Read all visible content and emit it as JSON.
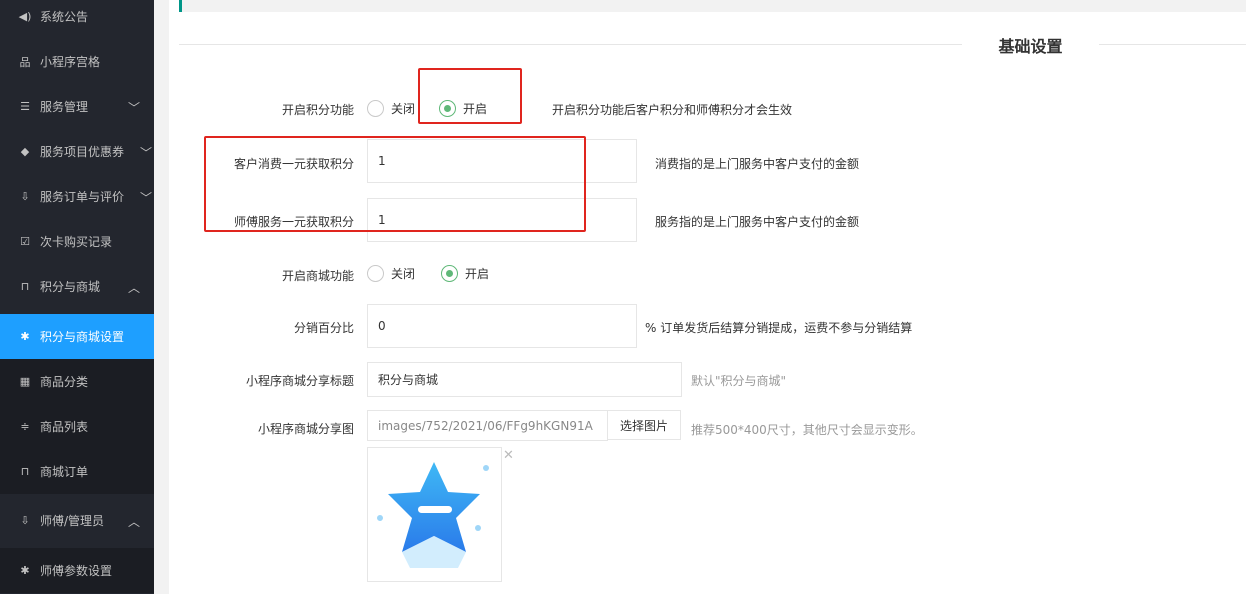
{
  "sidebar": {
    "items": [
      {
        "label": "系统公告",
        "icon": "volume-icon",
        "glyph": "◀)"
      },
      {
        "label": "小程序宫格",
        "icon": "sitemap-icon",
        "glyph": "品"
      },
      {
        "label": "服务管理",
        "icon": "list-icon",
        "glyph": "☰",
        "arrow": "﹀"
      },
      {
        "label": "服务项目优惠券",
        "icon": "tag-icon",
        "glyph": "◆",
        "arrow": "﹀"
      },
      {
        "label": "服务订单与评价",
        "icon": "download-icon",
        "glyph": "⇩",
        "arrow": "﹀"
      },
      {
        "label": "次卡购买记录",
        "icon": "check-square-icon",
        "glyph": "☑"
      },
      {
        "label": "积分与商城",
        "icon": "cart-icon",
        "glyph": "⊓",
        "arrow": "︿"
      },
      {
        "label": "积分与商城设置",
        "icon": "gear-icon",
        "glyph": "✱"
      },
      {
        "label": "商品分类",
        "icon": "grid-icon",
        "glyph": "▦"
      },
      {
        "label": "商品列表",
        "icon": "sliders-icon",
        "glyph": "≑"
      },
      {
        "label": "商城订单",
        "icon": "cart-icon",
        "glyph": "⊓"
      },
      {
        "label": "师傅/管理员",
        "icon": "download-icon",
        "glyph": "⇩",
        "arrow": "︿"
      },
      {
        "label": "师傅参数设置",
        "icon": "gear-icon",
        "glyph": "✱"
      }
    ]
  },
  "section": {
    "title": "基础设置"
  },
  "form": {
    "points_enable": {
      "label": "开启积分功能",
      "off": "关闭",
      "on": "开启",
      "selected": "开启",
      "hint": "开启积分功能后客户积分和师傅积分才会生效"
    },
    "customer_points": {
      "label": "客户消费一元获取积分",
      "value": "1",
      "hint": "消费指的是上门服务中客户支付的金额"
    },
    "master_points": {
      "label": "师傅服务一元获取积分",
      "value": "1",
      "hint": "服务指的是上门服务中客户支付的金额"
    },
    "mall_enable": {
      "label": "开启商城功能",
      "off": "关闭",
      "on": "开启",
      "selected": "开启"
    },
    "distribution": {
      "label": "分销百分比",
      "value": "0",
      "hint": "%  订单发货后结算分销提成，运费不参与分销结算"
    },
    "share_title": {
      "label": "小程序商城分享标题",
      "value": "积分与商城",
      "hint": "默认\"积分与商城\""
    },
    "share_image": {
      "label": "小程序商城分享图",
      "value": "images/752/2021/06/FFg9hKGN91A",
      "button": "选择图片",
      "hint": "推荐500*400尺寸，其他尺寸会显示变形。"
    }
  },
  "colors": {
    "accent": "#1e9fff",
    "radio_on": "#5fb878",
    "highlight": "#e0251e",
    "sidebar": "#23262e"
  }
}
